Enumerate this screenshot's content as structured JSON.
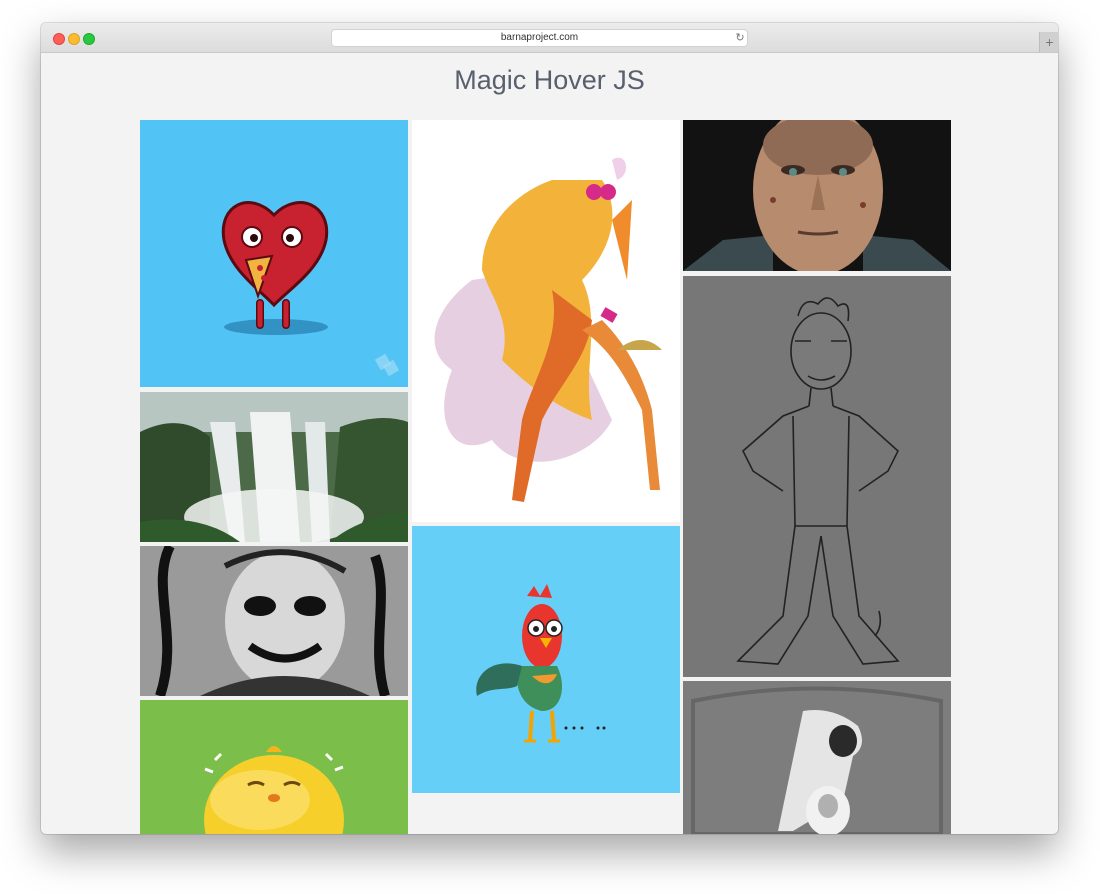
{
  "browser": {
    "url": "barnaproject.com",
    "reload_icon": "reload-icon",
    "new_tab_icon": "plus-icon"
  },
  "page": {
    "title": "Magic Hover JS"
  },
  "gallery": {
    "columns": [
      [
        "heart-pizza-illustration",
        "waterfall-photo",
        "joker-sketch-image",
        "yellow-chick-3d"
      ],
      [
        "orange-woman-illustration",
        "rooster-illustration"
      ],
      [
        "man-portrait-photo",
        "line-drawing-man",
        "stone-statue-photo"
      ]
    ]
  },
  "colors": {
    "window_bg": "#f3f3f4",
    "title": "#5a5f6e",
    "sky_blue": "#51c3f5",
    "light_blue": "#66cff8",
    "green": "#7bbf4a"
  }
}
